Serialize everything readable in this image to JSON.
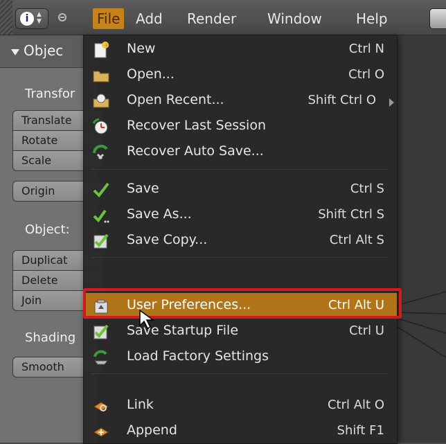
{
  "menubar": {
    "items": [
      "File",
      "Add",
      "Render",
      "Window",
      "Help"
    ]
  },
  "panel": {
    "title": "Objec",
    "sections": {
      "transform": "Transfor",
      "object": "Object:",
      "shading": "Shading"
    },
    "buttons": {
      "translate": "Translate",
      "rotate": "Rotate",
      "scale": "Scale",
      "origin": "Origin",
      "duplicate": "Duplicat",
      "delete": "Delete",
      "join": "Join",
      "smooth": "Smooth"
    }
  },
  "file_menu": {
    "items": [
      {
        "label": "New",
        "shortcut": "Ctrl N",
        "icon": "new-file-icon"
      },
      {
        "label": "Open...",
        "shortcut": "Ctrl O",
        "icon": "folder-icon"
      },
      {
        "label": "Open Recent...",
        "shortcut": "Shift Ctrl O",
        "icon": "open-recent-icon"
      },
      {
        "label": "Recover Last Session",
        "shortcut": "",
        "icon": "recover-icon"
      },
      {
        "label": "Recover Auto Save...",
        "shortcut": "",
        "icon": "auto-save-icon"
      },
      {
        "label": "Save",
        "shortcut": "Ctrl S",
        "icon": "checkmark-icon"
      },
      {
        "label": "Save As...",
        "shortcut": "Shift Ctrl S",
        "icon": "save-as-icon"
      },
      {
        "label": "Save Copy...",
        "shortcut": "Ctrl Alt S",
        "icon": "save-copy-icon"
      },
      {
        "label": "User Preferences...",
        "shortcut": "Ctrl Alt U",
        "icon": "preferences-icon"
      },
      {
        "label": "Save Startup File",
        "shortcut": "Ctrl U",
        "icon": "save-startup-icon"
      },
      {
        "label": "Load Factory Settings",
        "shortcut": "",
        "icon": "load-factory-icon"
      },
      {
        "label": "Link",
        "shortcut": "Ctrl Alt O",
        "icon": "link-icon"
      },
      {
        "label": "Append",
        "shortcut": "Shift F1",
        "icon": "append-icon"
      }
    ]
  },
  "colors": {
    "highlight": "#b07518",
    "annotation": "#d41a1a",
    "active_menu": "#c8821a"
  }
}
